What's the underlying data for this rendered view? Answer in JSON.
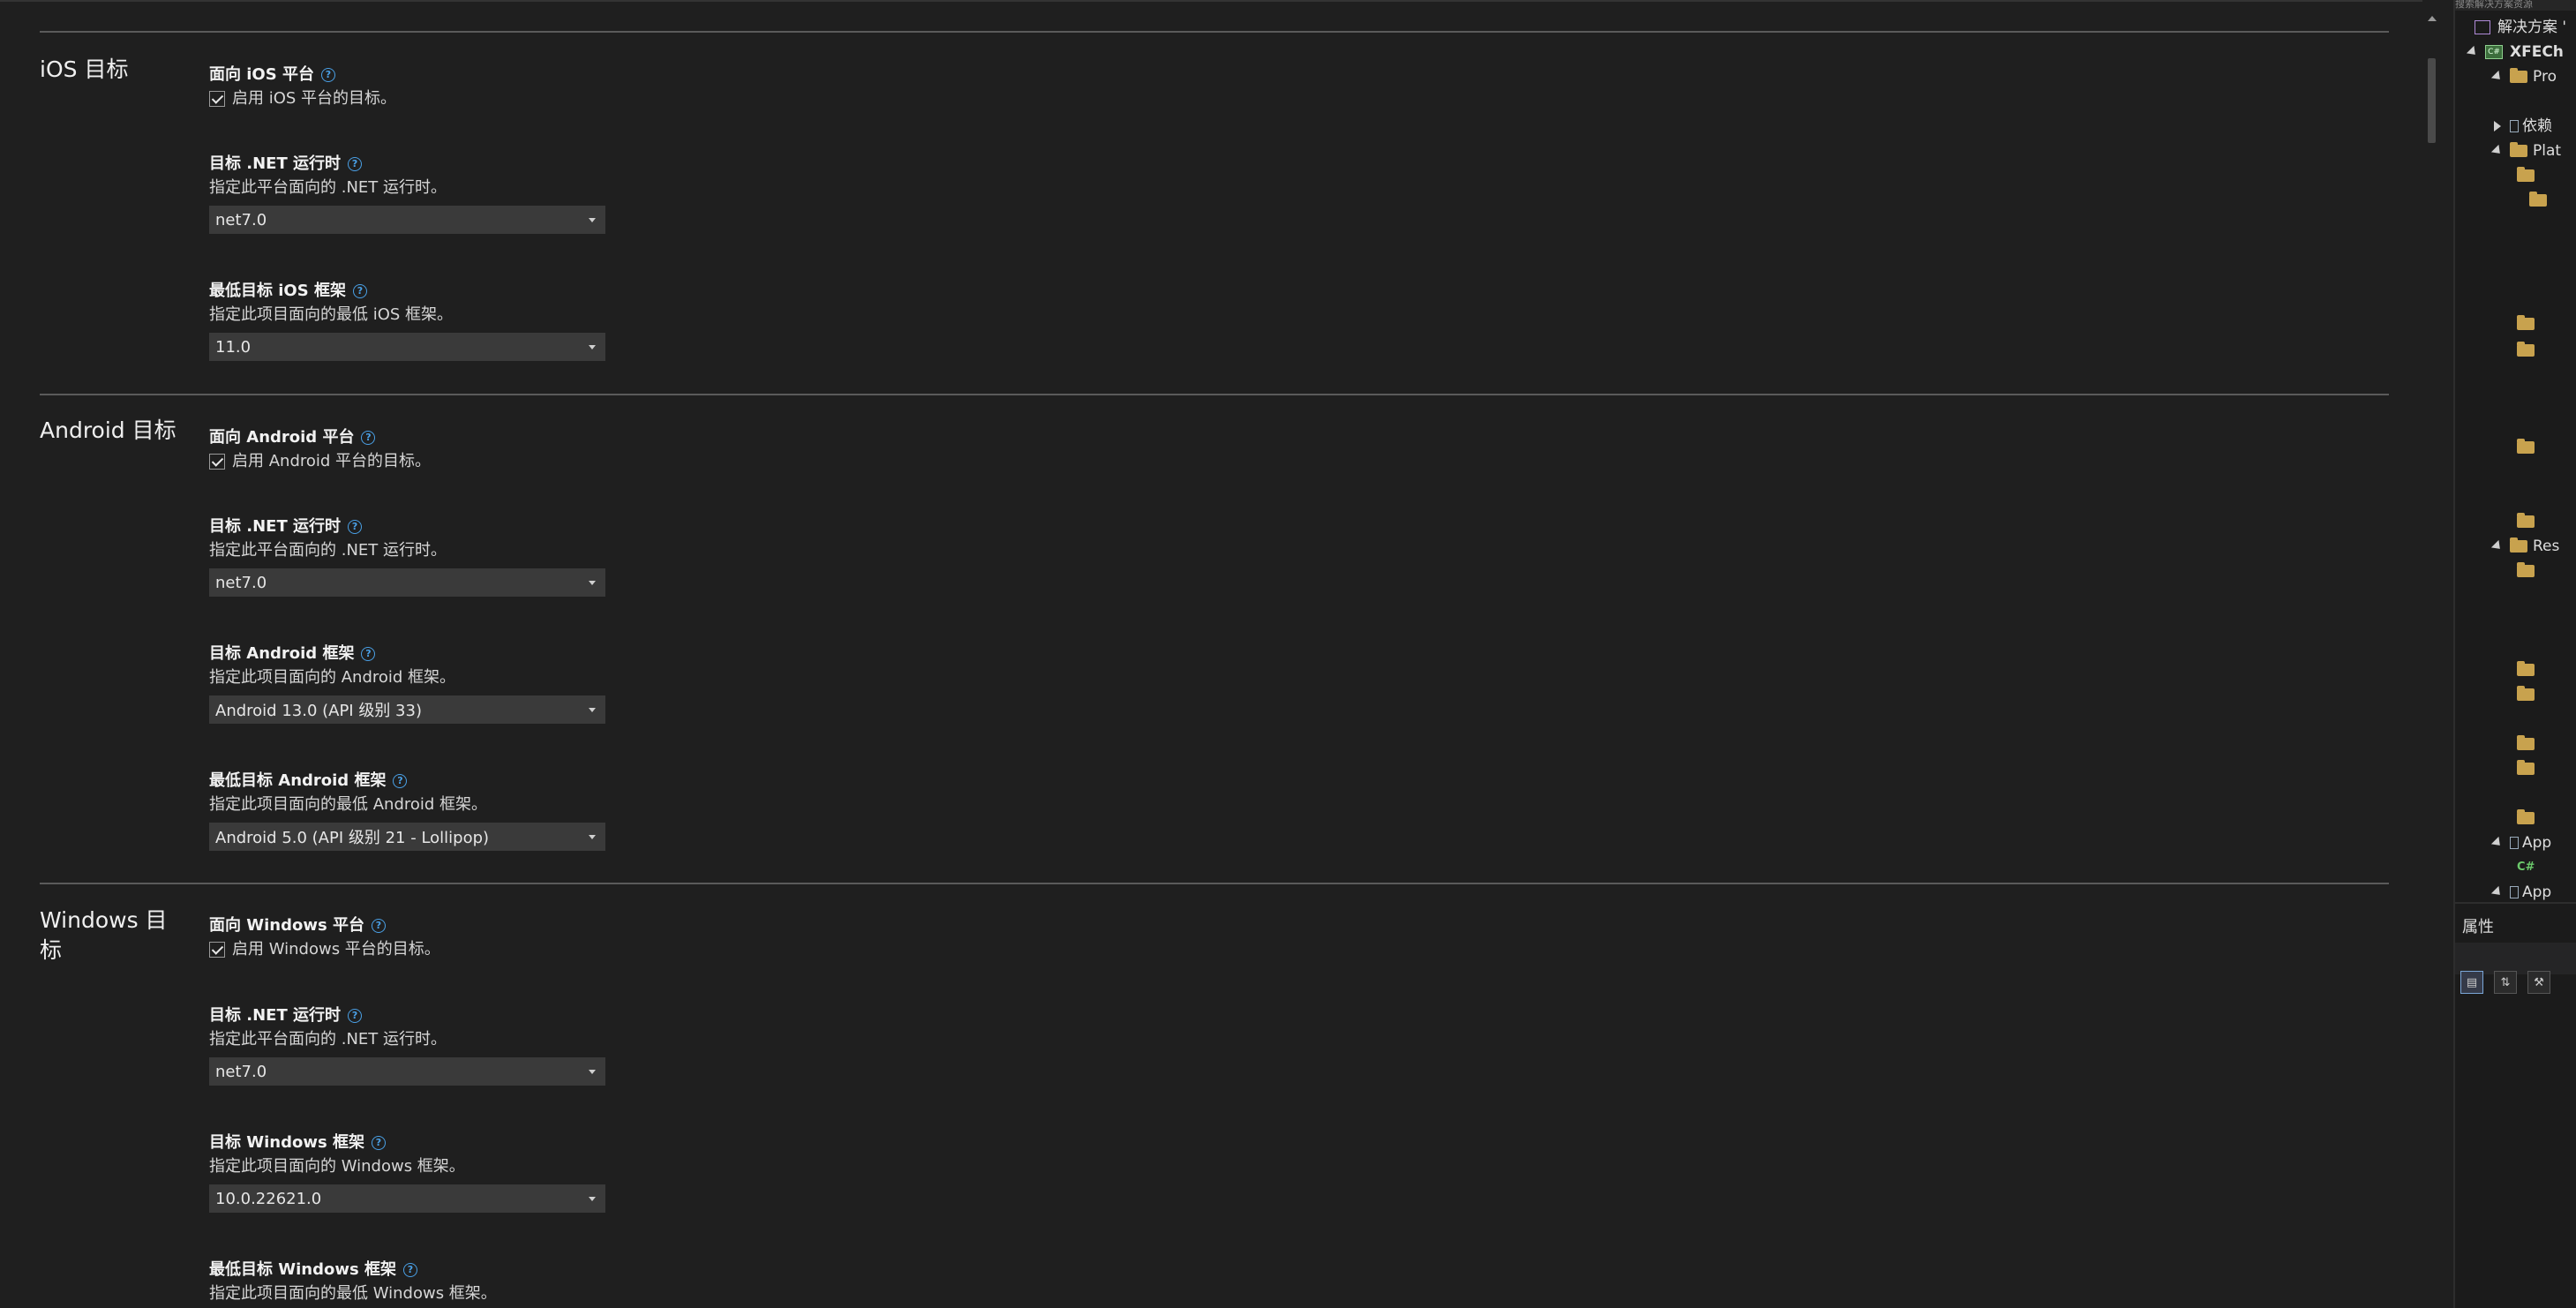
{
  "sections": [
    {
      "title": "iOS 目标",
      "fields": [
        {
          "label": "面向 iOS 平台",
          "checkbox": "启用 iOS 平台的目标。"
        },
        {
          "label": "目标 .NET 运行时",
          "desc": "指定此平台面向的 .NET 运行时。",
          "value": "net7.0"
        },
        {
          "label": "最低目标 iOS 框架",
          "desc": "指定此项目面向的最低 iOS 框架。",
          "value": "11.0"
        }
      ]
    },
    {
      "title": "Android 目标",
      "fields": [
        {
          "label": "面向 Android 平台",
          "checkbox": "启用 Android 平台的目标。"
        },
        {
          "label": "目标 .NET 运行时",
          "desc": "指定此平台面向的 .NET 运行时。",
          "value": "net7.0"
        },
        {
          "label": "目标 Android 框架",
          "desc": "指定此项目面向的 Android 框架。",
          "value": "Android 13.0 (API 级别 33)"
        },
        {
          "label": "最低目标 Android 框架",
          "desc": "指定此项目面向的最低 Android 框架。",
          "value": "Android 5.0 (API 级别 21 - Lollipop)"
        }
      ]
    },
    {
      "title": "Windows 目标",
      "fields": [
        {
          "label": "面向 Windows 平台",
          "checkbox": "启用 Windows 平台的目标。"
        },
        {
          "label": "目标 .NET 运行时",
          "desc": "指定此平台面向的 .NET 运行时。",
          "value": "net7.0"
        },
        {
          "label": "目标 Windows 框架",
          "desc": "指定此项目面向的 Windows 框架。",
          "value": "10.0.22621.0"
        },
        {
          "label": "最低目标 Windows 框架",
          "desc": "指定此项目面向的最低 Windows 框架。"
        }
      ]
    }
  ],
  "help_glyph": "?",
  "solution_explorer": {
    "header": "搜索解决方案资源",
    "solution_label": "解决方案 '",
    "project_label": "XFECh",
    "items": [
      "Pro",
      "依赖",
      "Plat",
      "Res",
      "App",
      "App"
    ]
  },
  "properties": {
    "title": "属性"
  },
  "colors": {
    "background": "#1f1f1f",
    "dropdown": "#3a3a3a",
    "help_accent": "#4aa0e6",
    "divider": "#5a5a5a"
  }
}
